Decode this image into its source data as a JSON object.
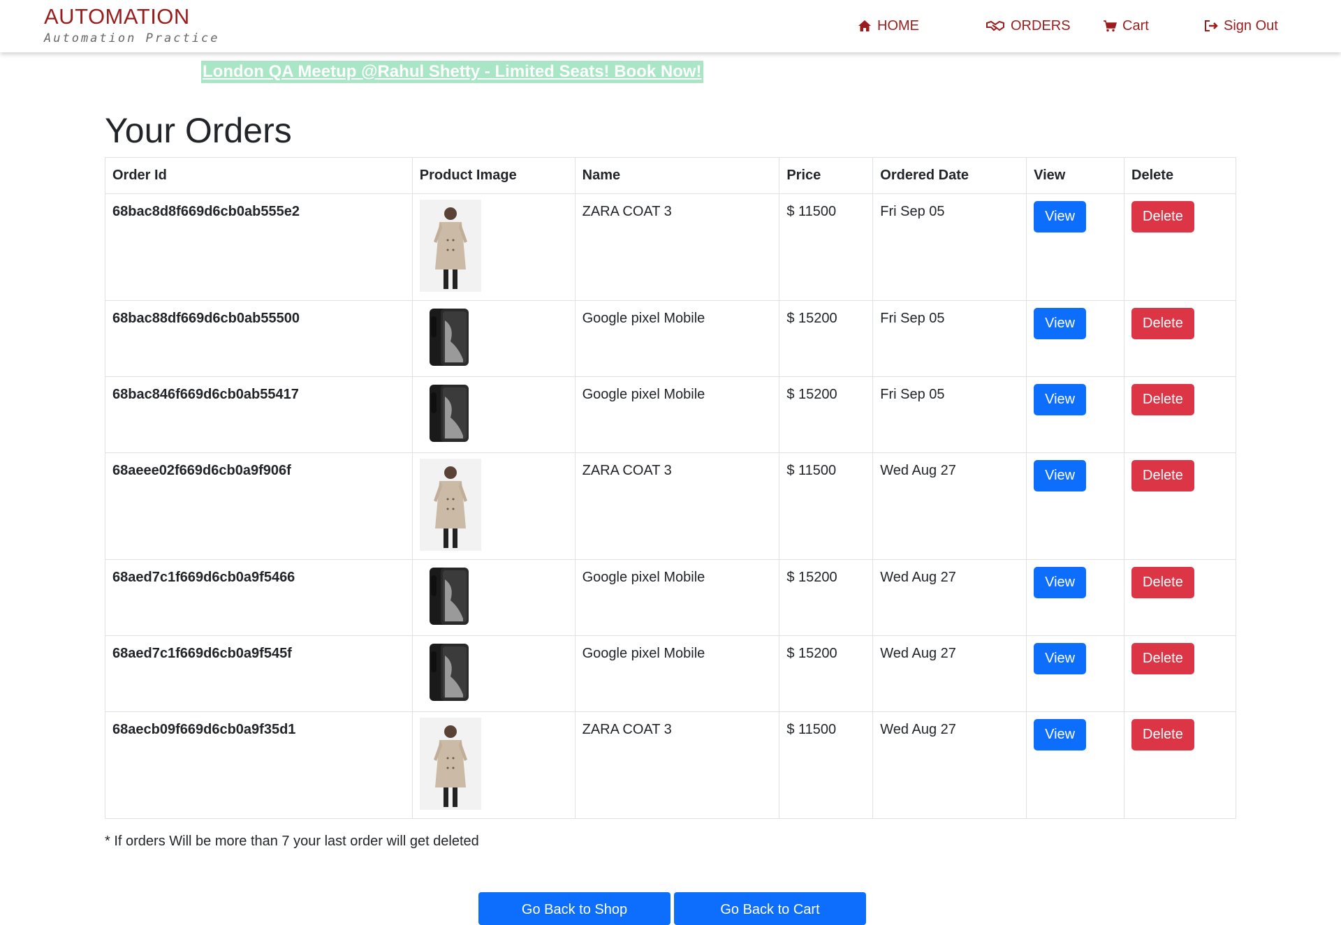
{
  "brand": {
    "title": "AUTOMATION",
    "subtitle": "Automation Practice"
  },
  "nav": [
    {
      "label": "HOME",
      "icon": "home-icon"
    },
    {
      "label": "ORDERS",
      "icon": "handshake-icon"
    },
    {
      "label": "Cart",
      "icon": "cart-icon"
    },
    {
      "label": "Sign Out",
      "icon": "sign-out-icon"
    }
  ],
  "banner": "London QA Meetup @Rahul Shetty - Limited Seats! Book Now!",
  "page_title": "Your Orders",
  "table": {
    "headers": [
      "Order Id",
      "Product Image",
      "Name",
      "Price",
      "Ordered Date",
      "View",
      "Delete"
    ],
    "rows": [
      {
        "id": "68bac8d8f669d6cb0ab555e2",
        "image": "coat",
        "name": "ZARA COAT 3",
        "price": "$ 11500",
        "date": "Fri Sep 05",
        "view": "View",
        "delete": "Delete"
      },
      {
        "id": "68bac88df669d6cb0ab55500",
        "image": "phone",
        "name": "Google pixel Mobile",
        "price": "$ 15200",
        "date": "Fri Sep 05",
        "view": "View",
        "delete": "Delete"
      },
      {
        "id": "68bac846f669d6cb0ab55417",
        "image": "phone",
        "name": "Google pixel Mobile",
        "price": "$ 15200",
        "date": "Fri Sep 05",
        "view": "View",
        "delete": "Delete"
      },
      {
        "id": "68aeee02f669d6cb0a9f906f",
        "image": "coat",
        "name": "ZARA COAT 3",
        "price": "$ 11500",
        "date": "Wed Aug 27",
        "view": "View",
        "delete": "Delete"
      },
      {
        "id": "68aed7c1f669d6cb0a9f5466",
        "image": "phone",
        "name": "Google pixel Mobile",
        "price": "$ 15200",
        "date": "Wed Aug 27",
        "view": "View",
        "delete": "Delete"
      },
      {
        "id": "68aed7c1f669d6cb0a9f545f",
        "image": "phone",
        "name": "Google pixel Mobile",
        "price": "$ 15200",
        "date": "Wed Aug 27",
        "view": "View",
        "delete": "Delete"
      },
      {
        "id": "68aecb09f669d6cb0a9f35d1",
        "image": "coat",
        "name": "ZARA COAT 3",
        "price": "$ 11500",
        "date": "Wed Aug 27",
        "view": "View",
        "delete": "Delete"
      }
    ]
  },
  "note": "* If orders Will be more than 7 your last order will get deleted",
  "buttons": {
    "shop": "Go Back to Shop",
    "cart": "Go Back to Cart"
  },
  "colors": {
    "brand": "#9b1c1c",
    "primary": "#0d6efd",
    "danger": "#dc3545",
    "banner_bg": "#a8e6c6"
  }
}
